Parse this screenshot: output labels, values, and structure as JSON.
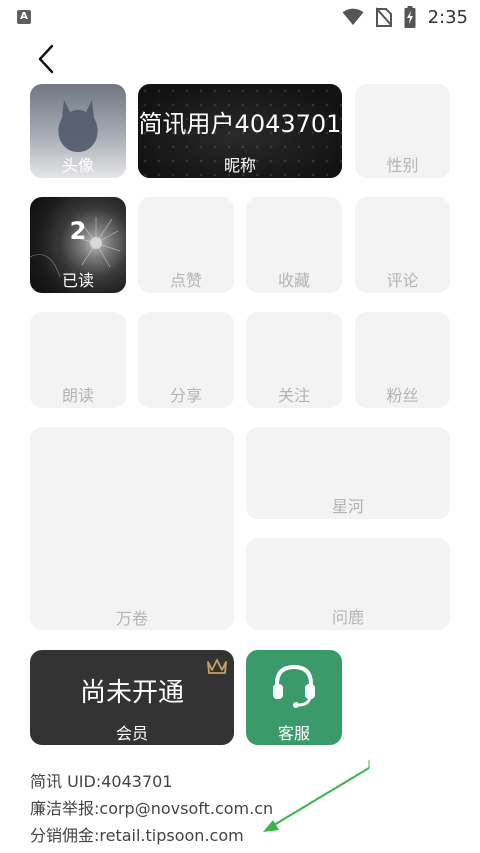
{
  "status_bar": {
    "left_icon": "A",
    "time": "2:35",
    "icons": [
      "wifi-icon",
      "no-sim-icon",
      "battery-charging-icon"
    ]
  },
  "profile": {
    "avatar_label": "头像",
    "nickname_value": "简讯用户4043701",
    "nickname_label": "昵称",
    "gender_label": "性别"
  },
  "stats": {
    "read_count": "2",
    "read_label": "已读",
    "like_label": "点赞",
    "favorite_label": "收藏",
    "comment_label": "评论",
    "recite_label": "朗读",
    "share_label": "分享",
    "follow_label": "关注",
    "fans_label": "粉丝"
  },
  "features": {
    "wanjuan_label": "万卷",
    "xinghe_label": "星河",
    "wenlu_label": "问鹿"
  },
  "membership": {
    "status_text": "尚未开通",
    "label": "会员",
    "service_label": "客服"
  },
  "footer": {
    "uid_line": "简讯 UID:4043701",
    "report_line": "廉洁举报:corp@novsoft.com.cn",
    "commission_line": "分销佣金:retail.tipsoon.com"
  },
  "colors": {
    "tile_bg": "#f3f3f3",
    "tile_label": "#b4b4b4",
    "service_green": "#3a9a6a",
    "member_dark": "#333333",
    "crown_gold": "#c8a064",
    "arrow_green": "#39b54a"
  }
}
